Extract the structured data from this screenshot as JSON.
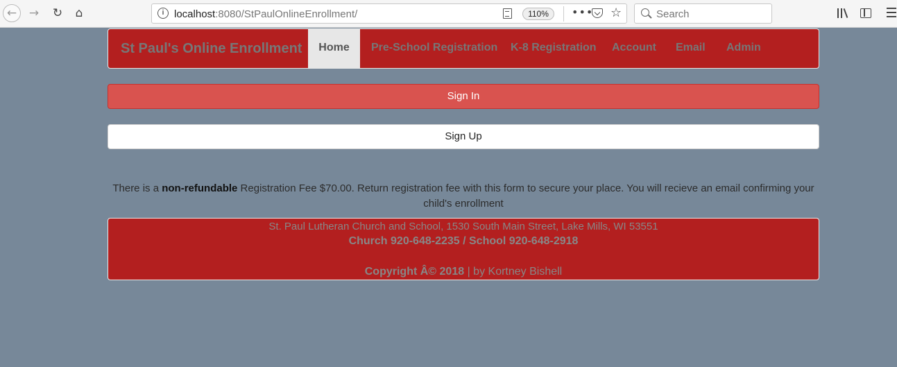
{
  "browser": {
    "url_host": "localhost",
    "url_rest": ":8080/StPaulOnlineEnrollment/",
    "zoom": "110%",
    "search_placeholder": "Search"
  },
  "navbar": {
    "brand": "St Paul's Online Enrollment",
    "items": [
      {
        "label": "Home",
        "active": true
      },
      {
        "label": "Pre-School Registration",
        "active": false
      },
      {
        "label": "K-8 Registration",
        "active": false
      },
      {
        "label": "Account",
        "active": false
      },
      {
        "label": "Email",
        "active": false
      },
      {
        "label": "Admin",
        "active": false
      }
    ]
  },
  "buttons": {
    "sign_in": "Sign In",
    "sign_up": "Sign Up"
  },
  "notice": {
    "prefix": "There is a ",
    "emphasis": "non-refundable",
    "suffix": " Registration Fee $70.00. Return registration fee with this form to secure your place. You will recieve an email confirming your child's enrollment"
  },
  "footer": {
    "address": "St. Paul Lutheran Church and School, 1530 South Main Street, Lake Mills, WI 53551",
    "phones": "Church 920-648-2235 / School 920-648-2918",
    "copyright": "Copyright Â© 2018",
    "author": " | by Kortney Bishell"
  },
  "colors": {
    "page_bg": "#778899",
    "brand_red": "#b31f1f",
    "signin_red": "#d9534f"
  }
}
